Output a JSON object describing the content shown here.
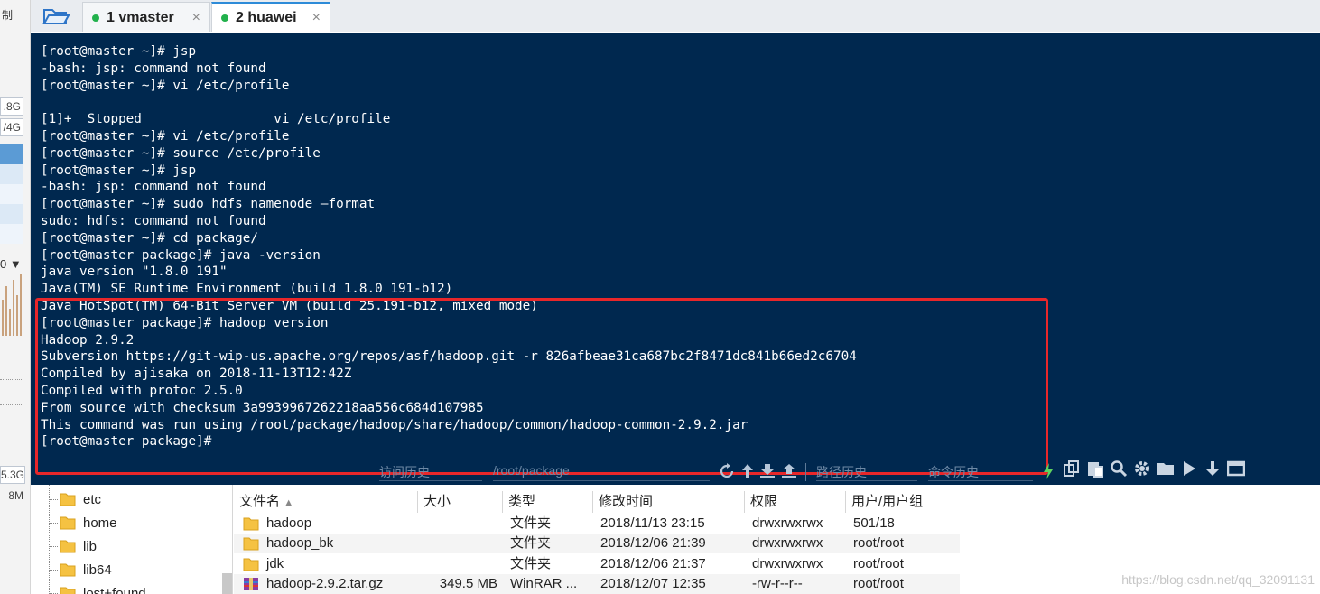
{
  "left_panel": {
    "top_label": "制",
    "values": [
      ".8G",
      "/4G"
    ],
    "arrow_label": "0",
    "lower_values": [
      "5.3G",
      "8M"
    ]
  },
  "tabs": [
    {
      "label": "1 vmaster",
      "close": "×",
      "status_color": "#22b14c",
      "active": false
    },
    {
      "label": "2 huawei",
      "close": "×",
      "status_color": "#22b14c",
      "active": true
    }
  ],
  "terminal": {
    "lines": [
      "[root@master ~]# jsp",
      "-bash: jsp: command not found",
      "[root@master ~]# vi /etc/profile",
      "",
      "[1]+  Stopped                 vi /etc/profile",
      "[root@master ~]# vi /etc/profile",
      "[root@master ~]# source /etc/profile",
      "[root@master ~]# jsp",
      "-bash: jsp: command not found",
      "[root@master ~]# sudo hdfs namenode —format",
      "sudo: hdfs: command not found",
      "[root@master ~]# cd package/",
      "[root@master package]# java -version",
      "java version \"1.8.0 191\"",
      "Java(TM) SE Runtime Environment (build 1.8.0 191-b12)",
      "Java HotSpot(TM) 64-Bit Server VM (build 25.191-b12, mixed mode)",
      "[root@master package]# hadoop version",
      "Hadoop 2.9.2",
      "Subversion https://git-wip-us.apache.org/repos/asf/hadoop.git -r 826afbeae31ca687bc2f8471dc841b66ed2c6704",
      "Compiled by ajisaka on 2018-11-13T12:42Z",
      "Compiled with protoc 2.5.0",
      "From source with checksum 3a9939967262218aa556c684d107985",
      "This command was run using /root/package/hadoop/share/hadoop/common/hadoop-common-2.9.2.jar",
      "[root@master package]#"
    ],
    "highlight_color": "#e8272a"
  },
  "toolbar": {
    "history_label": "访问历史",
    "path_value": "/root/package",
    "path_history_label": "路径历史",
    "command_history_label": "命令历史"
  },
  "file_tree": {
    "items": [
      "etc",
      "home",
      "lib",
      "lib64",
      "lost+found"
    ]
  },
  "file_table": {
    "headers": [
      "文件名",
      "大小",
      "类型",
      "修改时间",
      "权限",
      "用户/用户组"
    ],
    "rows": [
      {
        "name": "hadoop",
        "size": "",
        "type": "文件夹",
        "modified": "2018/11/13 23:15",
        "perms": "drwxrwxrwx",
        "owner": "501/18",
        "icon": "folder-icon"
      },
      {
        "name": "hadoop_bk",
        "size": "",
        "type": "文件夹",
        "modified": "2018/12/06 21:39",
        "perms": "drwxrwxrwx",
        "owner": "root/root",
        "icon": "folder-icon"
      },
      {
        "name": "jdk",
        "size": "",
        "type": "文件夹",
        "modified": "2018/12/06 21:37",
        "perms": "drwxrwxrwx",
        "owner": "root/root",
        "icon": "folder-icon"
      },
      {
        "name": "hadoop-2.9.2.tar.gz",
        "size": "349.5 MB",
        "type": "WinRAR ...",
        "modified": "2018/12/07 12:35",
        "perms": "-rw-r--r--",
        "owner": "root/root",
        "icon": "archive-icon"
      }
    ]
  },
  "watermark": "https://blog.csdn.net/qq_32091131",
  "colors": {
    "terminal_bg": "#00284f",
    "accent": "#2e8bd8",
    "folder": "#f5c242"
  }
}
